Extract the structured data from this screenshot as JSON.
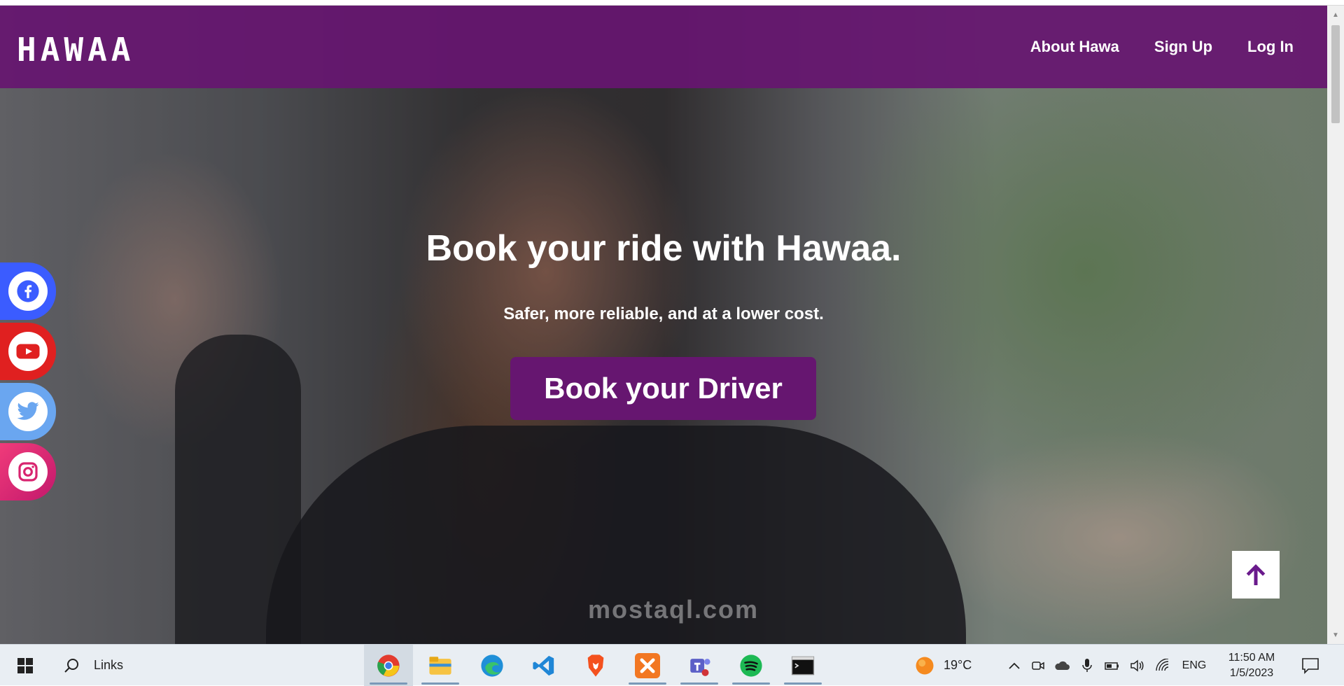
{
  "site": {
    "logo": "HAWAA",
    "nav": [
      "About Hawa",
      "Sign Up",
      "Log In"
    ],
    "hero_title": "Book your ride with Hawaa.",
    "hero_subtitle": "Safer, more reliable, and at a lower cost.",
    "cta_label": "Book your Driver",
    "brand_color": "#661670",
    "social": [
      {
        "name": "facebook",
        "icon": "facebook-icon",
        "color": "#3b5cff"
      },
      {
        "name": "youtube",
        "icon": "youtube-icon",
        "color": "#e02020"
      },
      {
        "name": "twitter",
        "icon": "twitter-icon",
        "color": "#6aa6f0"
      },
      {
        "name": "instagram",
        "icon": "instagram-icon",
        "color": "#e0307a"
      }
    ],
    "to_top_icon": "arrow-up-icon"
  },
  "watermark": "mostaql.com",
  "taskbar": {
    "search_label": "Links",
    "apps": [
      "chrome-icon",
      "file-explorer-icon",
      "edge-icon",
      "vscode-icon",
      "brave-icon",
      "xampp-icon",
      "teams-icon",
      "spotify-icon",
      "terminal-icon"
    ],
    "weather": "19°C",
    "language": "ENG",
    "time": "11:50 AM",
    "date": "1/5/2023"
  }
}
